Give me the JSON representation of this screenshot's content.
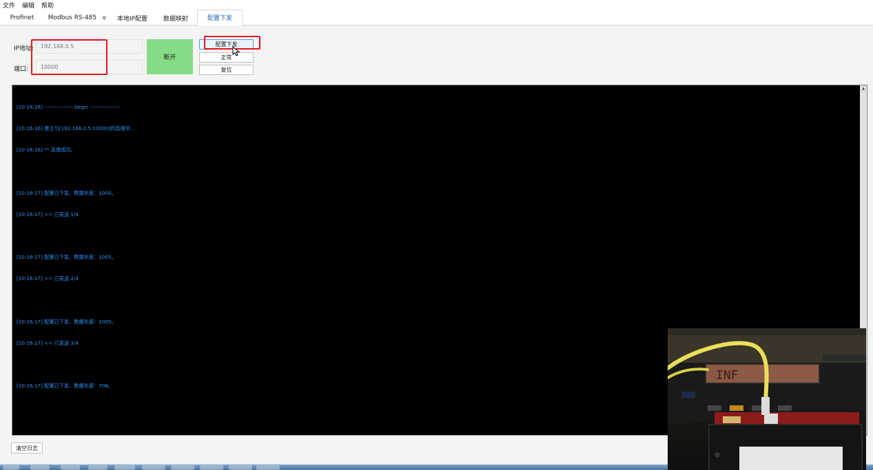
{
  "menu": [
    "文件",
    "编辑",
    "帮助"
  ],
  "tabs": [
    {
      "label": "Profinet",
      "active": false
    },
    {
      "label": "Modbus RS-485",
      "active": false
    },
    {
      "label": "本地IP配置",
      "active": false
    },
    {
      "label": "数据映射",
      "active": false
    },
    {
      "label": "配置下发",
      "active": true
    }
  ],
  "connection": {
    "ip_label": "IP地址:",
    "ip_placeholder": "192.168.0.5",
    "port_label": "端口:",
    "port_placeholder": "10000",
    "connect_button": "断开"
  },
  "actions": {
    "deploy_button": "配置下发",
    "normal_button": "正常",
    "reset_button": "复位"
  },
  "log": {
    "lines": [
      "[10:16:16] ---------------- begin -----------------",
      "[10:16:16] 建立与[192.168.0.5:10000]的连接中...",
      "[10:16:16] ** 连接成功。",
      "",
      "[10:16:17] 配置已下发，数据长度：1000。",
      "[10:16:17] << 已发送 1/4",
      "",
      "[10:16:17] 配置已下发，数据长度：1005。",
      "[10:16:17] << 已发送 2/4",
      "",
      "[10:16:17] 配置已下发，数据长度：1005。",
      "[10:16:17] << 已发送 3/4",
      "",
      "[10:16:17] 配置已下发，数据长度：708。"
    ],
    "clear_button": "清空日志"
  },
  "device_display": "INF",
  "colors": {
    "accent": "#1e62b5",
    "log_text": "#2e93f2",
    "connected": "#86dc86",
    "highlight": "#e8141c"
  }
}
